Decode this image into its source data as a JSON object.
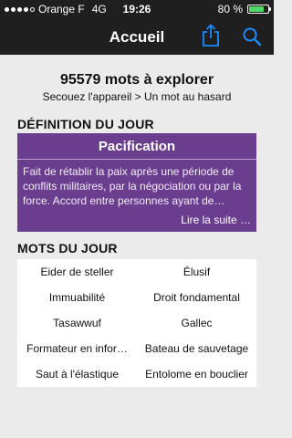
{
  "status_bar": {
    "carrier": "Orange F",
    "network": "4G",
    "time": "19:26",
    "battery_percent": "80 %",
    "battery_level": 0.8,
    "signal_bars_filled": 4,
    "signal_bars_total": 5
  },
  "navbar": {
    "title": "Accueil",
    "share_icon": "share-icon",
    "search_icon": "search-icon",
    "accent_color": "#1a8cff"
  },
  "header": {
    "count_text": "95579 mots à explorer",
    "shake_text": "Secouez l'appareil > Un mot au hasard"
  },
  "definition": {
    "section_title": "DÉFINITION DU JOUR",
    "word": "Pacification",
    "text": "Fait de rétablir la paix après une période de conflits militaires, par la négociation ou par la force. Accord entre personnes ayant de…",
    "read_more": "Lire la suite …",
    "card_color": "#6a3d8f"
  },
  "words_of_day": {
    "section_title": "MOTS DU JOUR",
    "items": [
      "Eider de steller",
      "Élusif",
      "Immuabilité",
      "Droit fondamental",
      "Tasawwuf",
      "Gallec",
      "Formateur en infor…",
      "Bateau de sauvetage",
      "Saut à l'élastique",
      "Entolome en bouclier"
    ]
  }
}
